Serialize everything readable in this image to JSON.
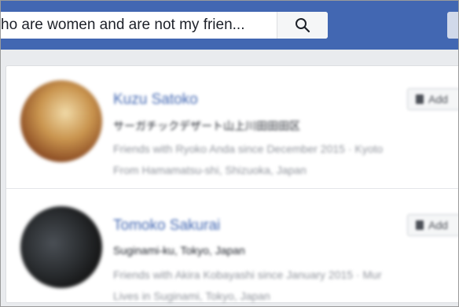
{
  "search": {
    "query": "ho are women and are not my frien...",
    "button_icon": "search-icon"
  },
  "results": [
    {
      "name": "Kuzu Satoko",
      "line1": "サーガチックデザート山上川田田田区",
      "line2": "Friends with Ryoko Anda since December 2015 · Kyoto",
      "line3": "From Hamamatsu-shi, Shizuoka, Japan",
      "button_label": "Add"
    },
    {
      "name": "Tomoko Sakurai",
      "line1": "Suginami-ku, Tokyo, Japan",
      "line2": "Friends with Akira Kobayashi since January 2015 · Mur",
      "line3": "Lives in Suginami, Tokyo, Japan",
      "button_label": "Add"
    }
  ]
}
